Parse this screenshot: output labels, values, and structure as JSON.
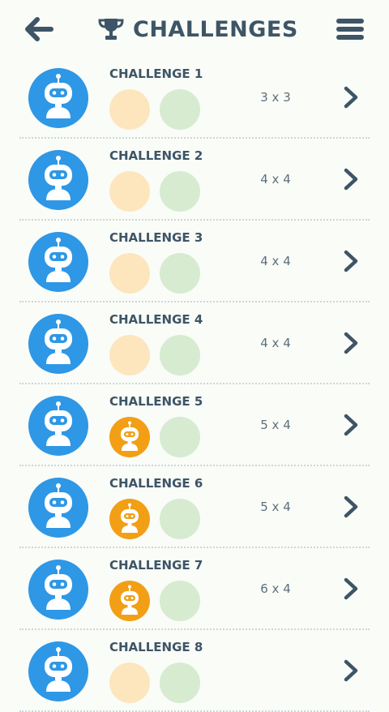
{
  "header": {
    "title": "CHALLENGES",
    "icons": {
      "back": "arrow-left-icon",
      "title": "trophy-icon",
      "menu": "hamburger-menu-icon"
    }
  },
  "colors": {
    "text": "#3d5566",
    "avatar_blue": "#2e97e6",
    "medal_orange_active": "#f29f16",
    "medal_orange_inactive": "#fde6bd",
    "medal_green_inactive": "#d6ebd0"
  },
  "challenges": [
    {
      "title": "CHALLENGE 1",
      "size": "3 x 3",
      "medal1_active": false,
      "medal2_active": false
    },
    {
      "title": "CHALLENGE 2",
      "size": "4 x 4",
      "medal1_active": false,
      "medal2_active": false
    },
    {
      "title": "CHALLENGE 3",
      "size": "4 x 4",
      "medal1_active": false,
      "medal2_active": false
    },
    {
      "title": "CHALLENGE 4",
      "size": "4 x 4",
      "medal1_active": false,
      "medal2_active": false
    },
    {
      "title": "CHALLENGE 5",
      "size": "5 x 4",
      "medal1_active": true,
      "medal2_active": false
    },
    {
      "title": "CHALLENGE 6",
      "size": "5 x 4",
      "medal1_active": true,
      "medal2_active": false
    },
    {
      "title": "CHALLENGE 7",
      "size": "6 x 4",
      "medal1_active": true,
      "medal2_active": false
    },
    {
      "title": "CHALLENGE 8",
      "size": "",
      "medal1_active": false,
      "medal2_active": false
    }
  ]
}
